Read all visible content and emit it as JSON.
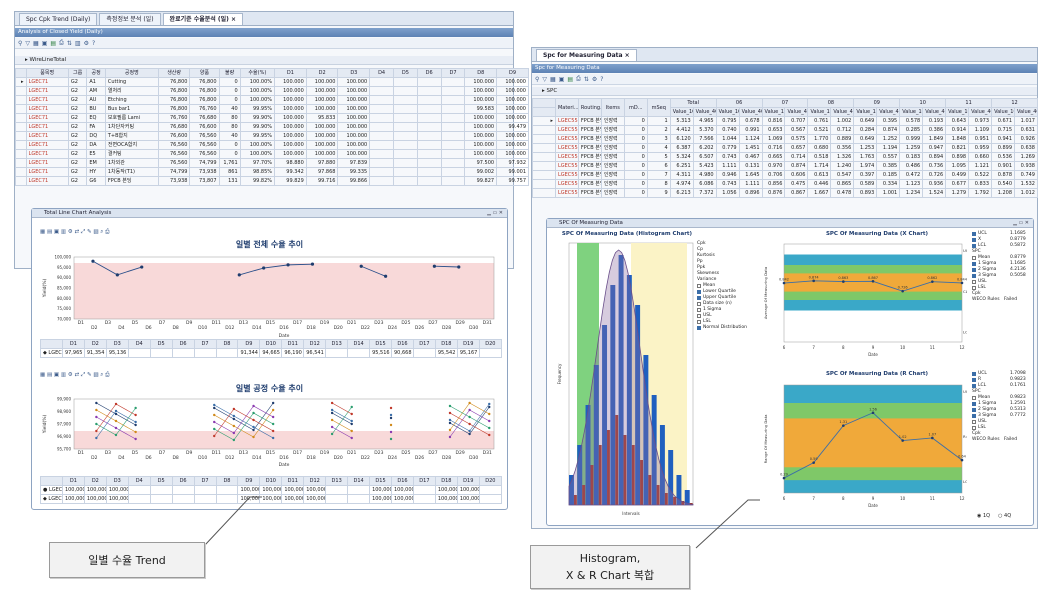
{
  "left_window": {
    "tabs": [
      {
        "label": "Spc Cpk Trend (Daily)"
      },
      {
        "label": "측정정보 분석 (일)"
      },
      {
        "label": "완료기준 수율분석 (일) ×"
      }
    ],
    "caption": "Analysis of Closed Yield (Daily)",
    "group_label": "WireLineTotal",
    "columns": [
      "품목명",
      "그룹",
      "공정",
      "공정명",
      "생산량",
      "양품",
      "불량",
      "수율(%)",
      "D1",
      "D2",
      "D3",
      "D4",
      "D5",
      "D6",
      "D7",
      "D8",
      "D9"
    ],
    "rows": [
      [
        "LGEC71",
        "G2",
        "A1",
        "Cutting",
        "76,800",
        "76,800",
        "0",
        "100.00%",
        "100.000",
        "100.000",
        "100.000",
        "",
        "",
        "",
        "",
        "100.000",
        "100.000"
      ],
      [
        "LGEC71",
        "G2",
        "AM",
        "열처리",
        "76,800",
        "76,800",
        "0",
        "100.00%",
        "100.000",
        "100.000",
        "100.000",
        "",
        "",
        "",
        "",
        "100.000",
        "100.000"
      ],
      [
        "LGEC71",
        "G2",
        "AU",
        "Etching",
        "76,800",
        "76,800",
        "0",
        "100.00%",
        "100.000",
        "100.000",
        "100.000",
        "",
        "",
        "",
        "",
        "100.000",
        "100.000"
      ],
      [
        "LGEC71",
        "G2",
        "BU",
        "Bus bar1",
        "76,800",
        "76,760",
        "40",
        "99.95%",
        "100.000",
        "100.000",
        "100.000",
        "",
        "",
        "",
        "",
        "99.583",
        "100.000"
      ],
      [
        "LGEC71",
        "G2",
        "EQ",
        "보호필름 Lami",
        "76,760",
        "76,680",
        "80",
        "99.90%",
        "100.000",
        "95.833",
        "100.000",
        "",
        "",
        "",
        "",
        "100.000",
        "100.000"
      ],
      [
        "LGEC71",
        "G2",
        "FA",
        "1차단자커팅",
        "76,680",
        "76,600",
        "80",
        "99.90%",
        "100.000",
        "100.000",
        "100.000",
        "",
        "",
        "",
        "",
        "100.000",
        "99.479"
      ],
      [
        "LGEC71",
        "G2",
        "DQ",
        "T+B합지",
        "76,600",
        "76,560",
        "40",
        "99.95%",
        "100.000",
        "100.000",
        "100.000",
        "",
        "",
        "",
        "",
        "100.000",
        "100.000"
      ],
      [
        "LGEC71",
        "G2",
        "DA",
        "전면OCA합지",
        "76,560",
        "76,560",
        "0",
        "100.00%",
        "100.000",
        "100.000",
        "100.000",
        "",
        "",
        "",
        "",
        "100.000",
        "100.000"
      ],
      [
        "LGEC71",
        "G2",
        "E5",
        "결커팅",
        "76,560",
        "76,560",
        "0",
        "100.00%",
        "100.000",
        "100.000",
        "100.000",
        "",
        "",
        "",
        "",
        "100.000",
        "100.000"
      ],
      [
        "LGEC71",
        "G2",
        "EM",
        "1차외관",
        "76,560",
        "74,799",
        "1,761",
        "97.70%",
        "98.880",
        "97.880",
        "97.839",
        "",
        "",
        "",
        "",
        "97.500",
        "97.932"
      ],
      [
        "LGEC71",
        "G2",
        "HY",
        "1차동작(T1)",
        "74,799",
        "73,938",
        "861",
        "98.85%",
        "99.342",
        "97.868",
        "99.335",
        "",
        "",
        "",
        "",
        "99.002",
        "99.001"
      ],
      [
        "LGEC71",
        "G2",
        "G6",
        "FPCB 본딩",
        "73,938",
        "73,807",
        "131",
        "99.82%",
        "99.829",
        "99.716",
        "99.866",
        "",
        "",
        "",
        "",
        "99.827",
        "99.757"
      ]
    ],
    "line_panel": {
      "window_title": "Total Line Chart Analysis",
      "chart1": {
        "title": "일별 전체 수율 추이",
        "ylabel": "Yield(%)",
        "xlabel": "Date",
        "yticks": [
          "100,000",
          "95,000",
          "90,000",
          "85,000",
          "80,000",
          "75,000",
          "70,000"
        ],
        "table_header": [
          "D1",
          "D2",
          "D3",
          "D4",
          "D5",
          "D6",
          "D7",
          "D8",
          "D9",
          "D10",
          "D11",
          "D12",
          "D13",
          "D14",
          "D15",
          "D16",
          "D17",
          "D18",
          "D19",
          "D20"
        ],
        "table_row_label": "LGEC71",
        "table_values": [
          "97,965",
          "91,354",
          "95,136",
          "",
          "",
          "",
          "",
          "",
          "91,344",
          "94,665",
          "96,190",
          "96,541",
          "",
          "",
          "95,516",
          "90,668",
          "",
          "95,542",
          "95,167",
          ""
        ]
      },
      "chart2": {
        "title": "일별 공정 수율 추이",
        "ylabel": "Yield(%)",
        "xlabel": "Date",
        "yticks": [
          "99,900",
          "98,900",
          "97,900",
          "96,900",
          "95,700"
        ],
        "table_header": [
          "D1",
          "D2",
          "D3",
          "D4",
          "D5",
          "D6",
          "D7",
          "D8",
          "D9",
          "D10",
          "D11",
          "D12",
          "D13",
          "D14",
          "D15",
          "D16",
          "D17",
          "D18",
          "D19",
          "D20"
        ],
        "rows": [
          {
            "label": "LGEC71-Cutting",
            "values": [
              "100,000",
              "100,000",
              "100,000",
              "",
              "",
              "",
              "",
              "",
              "100,000",
              "100,000",
              "100,000",
              "100,000",
              "",
              "",
              "100,000",
              "100,000",
              "",
              "100,000",
              "100,000",
              ""
            ]
          },
          {
            "label": "LGEC71-열처리",
            "values": [
              "100,000",
              "100,000",
              "100,000",
              "",
              "",
              "",
              "",
              "",
              "100,000",
              "100,000",
              "100,000",
              "100,000",
              "",
              "",
              "100,000",
              "100,000",
              "",
              "100,000",
              "100,000",
              ""
            ]
          }
        ]
      },
      "xticks": [
        "D1",
        "D2",
        "D3",
        "D4",
        "D5",
        "D6",
        "D7",
        "D8",
        "D9",
        "D10",
        "D11",
        "D12",
        "D13",
        "D14",
        "D15",
        "D16",
        "D17",
        "D18",
        "D19",
        "D20",
        "D21",
        "D22",
        "D23",
        "D24",
        "D25",
        "D26",
        "D27",
        "D28",
        "D29",
        "D30",
        "D31"
      ]
    }
  },
  "right_window": {
    "tab": "Spc for Measuring Data ×",
    "caption": "Spc for Measuring Data",
    "group_label": "SPC",
    "columns_top": [
      "Materi...",
      "Routing...",
      "Items",
      "mD...",
      "mSeq",
      "Total",
      "06",
      "07",
      "08",
      "09",
      "10",
      "11",
      "12"
    ],
    "columns_sub": [
      "Value_1Q",
      "Value_4Q"
    ],
    "rows": [
      [
        "LGEC55",
        "FPCB 본딩",
        "인장력",
        "0",
        "1",
        "5.313",
        "4.965",
        "0.795",
        "0.678",
        "0.816",
        "0.707",
        "0.761",
        "1.002",
        "0.649",
        "0.395",
        "0.578",
        "0.193",
        "0.643",
        "0.973",
        "0.671",
        "1.017"
      ],
      [
        "LGEC55",
        "FPCB 본딩",
        "인장력",
        "0",
        "2",
        "4.412",
        "5.370",
        "0.740",
        "0.991",
        "0.653",
        "0.567",
        "0.521",
        "0.712",
        "0.284",
        "0.874",
        "0.285",
        "0.386",
        "0.914",
        "1.109",
        "0.715",
        "0.631"
      ],
      [
        "LGEC55",
        "FPCB 본딩",
        "인장력",
        "0",
        "3",
        "6.120",
        "7.566",
        "1.044",
        "1.124",
        "1.069",
        "0.575",
        "1.770",
        "0.889",
        "0.649",
        "1.252",
        "0.999",
        "1.849",
        "1.848",
        "0.951",
        "0.941",
        "0.926"
      ],
      [
        "LGEC55",
        "FPCB 본딩",
        "인장력",
        "0",
        "4",
        "6.387",
        "6.202",
        "0.779",
        "1.451",
        "0.716",
        "0.657",
        "0.680",
        "0.356",
        "1.253",
        "1.194",
        "1.259",
        "0.947",
        "0.821",
        "0.959",
        "0.899",
        "0.638"
      ],
      [
        "LGEC55",
        "FPCB 본딩",
        "인장력",
        "0",
        "5",
        "5.324",
        "6.507",
        "0.743",
        "0.467",
        "0.665",
        "0.714",
        "0.518",
        "1.326",
        "1.763",
        "0.557",
        "0.183",
        "0.894",
        "0.898",
        "0.660",
        "0.536",
        "1.269"
      ],
      [
        "LGEC55",
        "FPCB 본딩",
        "인장력",
        "0",
        "6",
        "6.251",
        "5.423",
        "1.111",
        "0.131",
        "0.970",
        "0.874",
        "1.714",
        "1.240",
        "1.974",
        "0.385",
        "0.486",
        "0.736",
        "1.095",
        "1.121",
        "0.901",
        "0.938"
      ],
      [
        "LGEC55",
        "FPCB 본딩",
        "인장력",
        "0",
        "7",
        "4.311",
        "4.980",
        "0.946",
        "1.645",
        "0.706",
        "0.606",
        "0.613",
        "0.547",
        "0.397",
        "0.185",
        "0.472",
        "0.726",
        "0.499",
        "0.522",
        "0.878",
        "0.749"
      ],
      [
        "LGEC55",
        "FPCB 본딩",
        "인장력",
        "0",
        "8",
        "4.974",
        "6.086",
        "0.743",
        "1.111",
        "0.856",
        "0.475",
        "0.446",
        "0.865",
        "0.589",
        "0.334",
        "1.123",
        "0.936",
        "0.677",
        "0.833",
        "0.540",
        "1.532"
      ],
      [
        "LGEC55",
        "FPCB 본딩",
        "인장력",
        "0",
        "9",
        "6.213",
        "7.372",
        "1.056",
        "0.896",
        "0.876",
        "0.867",
        "1.667",
        "0.478",
        "0.893",
        "1.001",
        "1.234",
        "1.524",
        "1.279",
        "1.792",
        "1.208",
        "1.012"
      ]
    ],
    "spc_panel": {
      "window_title": "SPC Of Measuring Data",
      "histogram": {
        "title": "SPC Of Measuring Data (Histogram Chart)",
        "xlabel": "Intervals",
        "ylabel": "Frequency",
        "legend": [
          "Cpk",
          "Cp",
          "Kurtosis",
          "Pp",
          "Ppk",
          "Skewness",
          "Variance",
          "Mean",
          "Lower Quartile",
          "Upper Quartile",
          "Data size (n)",
          "1 Sigma",
          "USL",
          "LSL",
          "Normal Distribution"
        ]
      },
      "xchart": {
        "title": "SPC Of Measuring Data (X Chart)",
        "xlabel": "Date",
        "ylabel": "Average Of Measuring Data",
        "xticks": [
          "6",
          "7",
          "8",
          "9",
          "10",
          "11",
          "12"
        ],
        "points": [
          0.842,
          0.874,
          0.863,
          0.867,
          0.726,
          0.862,
          0.844
        ],
        "labels": [
          "UCL=1.186",
          "CL=0.878",
          "LCL=0.567"
        ],
        "legend": [
          [
            "UCL",
            "1.1685"
          ],
          [
            "X",
            "0.8779"
          ],
          [
            "LCL",
            "0.5872"
          ],
          [
            "SPC",
            ""
          ],
          [
            "Mean",
            "0.8779"
          ],
          [
            "1 Sigma",
            "1.1685"
          ],
          [
            "2 Sigma",
            "4.2136"
          ],
          [
            "3 Sigma",
            "0.5058"
          ],
          [
            "USL",
            ""
          ],
          [
            "LSL",
            ""
          ],
          [
            "Cpk",
            ""
          ],
          [
            "WECO Rules",
            "Failed"
          ]
        ]
      },
      "rchart": {
        "title": "SPC Of Measuring Data (R Chart)",
        "xlabel": "Date",
        "ylabel": "Range Of Measuring Data",
        "xticks": [
          "6",
          "7",
          "8",
          "9",
          "10",
          "11",
          "12"
        ],
        "points": [
          0.29,
          0.59,
          1.31,
          1.56,
          1.02,
          1.07,
          0.64
        ],
        "labels": [
          "UCL=2",
          "R=1",
          "LCL=0"
        ],
        "legend": [
          [
            "UCL",
            "1.7098"
          ],
          [
            "R",
            "0.9823"
          ],
          [
            "LCL",
            "0.1761"
          ],
          [
            "SPC",
            ""
          ],
          [
            "Mean",
            "0.9823"
          ],
          [
            "1 Sigma",
            "1.2591"
          ],
          [
            "2 Sigma",
            "0.5313"
          ],
          [
            "3 Sigma",
            "0.7772"
          ],
          [
            "USL",
            ""
          ],
          [
            "LSL",
            ""
          ],
          [
            "Cpk",
            ""
          ],
          [
            "WECO Rules",
            "Failed"
          ]
        ]
      },
      "radio": [
        "1Q",
        "4Q"
      ]
    }
  },
  "callouts": {
    "left": "일별 수율 Trend",
    "right_line1": "Histogram,",
    "right_line2": "X & R Chart 복합"
  }
}
